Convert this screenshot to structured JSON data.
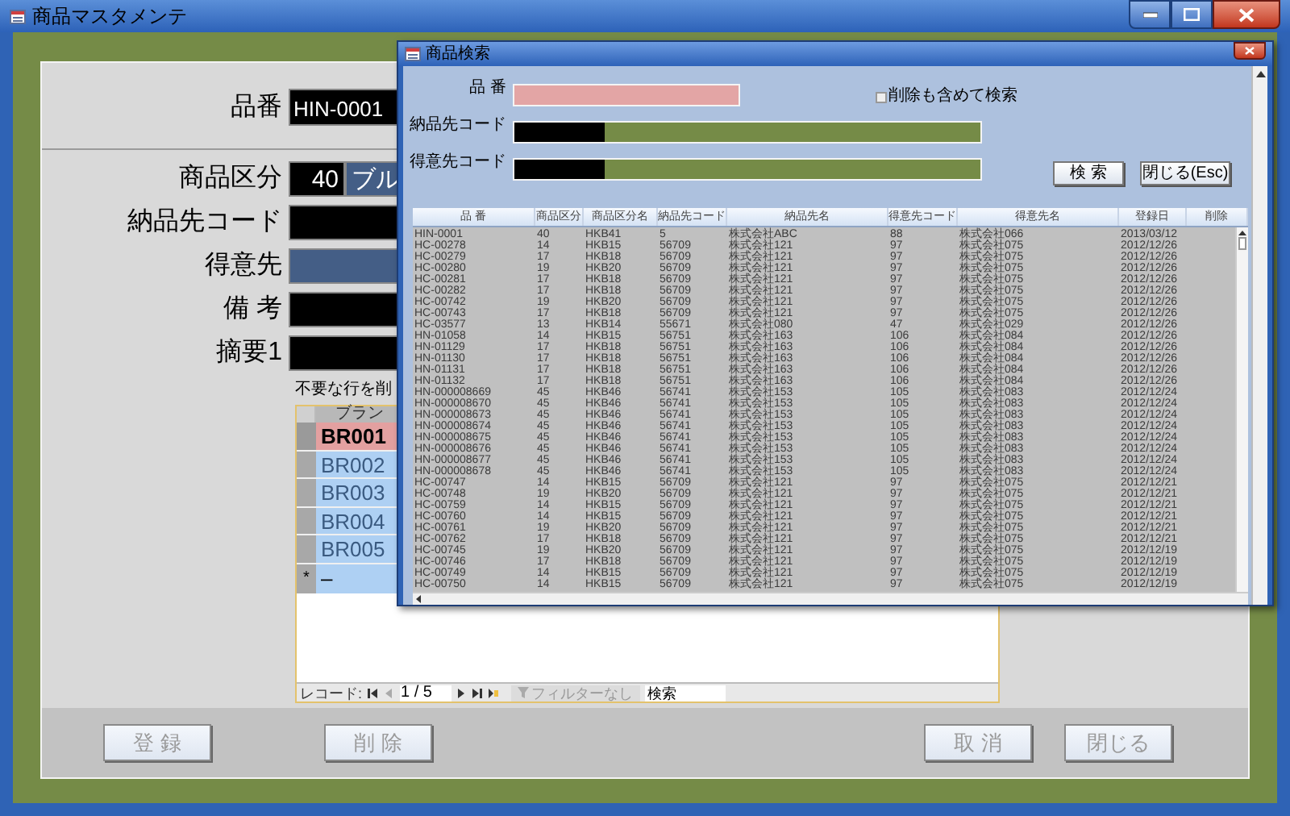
{
  "window": {
    "title": "商品マスタメンテ"
  },
  "form": {
    "key_field": {
      "label": "品番",
      "value": "HIN-0001"
    },
    "fields": [
      {
        "label": "商品区分",
        "kind": "code_name",
        "code": "40",
        "value": "ブル"
      },
      {
        "label": "納品先コード",
        "kind": "text",
        "locked": false
      },
      {
        "label": "得意先",
        "kind": "text",
        "locked": true
      },
      {
        "label": "備 考",
        "kind": "text",
        "locked": false
      },
      {
        "label": "摘要1",
        "kind": "text",
        "locked": false
      }
    ],
    "note": "不要な行を削",
    "subform": {
      "header": "ブラン",
      "rows": [
        {
          "value": "BR001",
          "selected": true
        },
        {
          "value": "BR002",
          "selected": false
        },
        {
          "value": "BR003",
          "selected": false
        },
        {
          "value": "BR004",
          "selected": false
        },
        {
          "value": "BR005",
          "selected": false
        }
      ],
      "new_row": {
        "marker": "*",
        "value": "–"
      },
      "navigation": {
        "label": "レコード:",
        "position": "1 / 5",
        "filter": "フィルターなし",
        "search": "検索"
      }
    }
  },
  "buttons": [
    "登 録",
    "削 除",
    "取 消",
    "閉じる"
  ],
  "dialog": {
    "title": "商品検索",
    "fields": [
      {
        "label": "品 番",
        "kind": "text"
      },
      {
        "label": "納品先コード",
        "kind": "code_name"
      },
      {
        "label": "得意先コード",
        "kind": "code_name"
      }
    ],
    "checkbox": {
      "label": "削除も含めて検索",
      "checked": false
    },
    "buttons": [
      "検 索",
      "閉じる(Esc)"
    ],
    "table": {
      "columns": [
        "品 番",
        "商品区分",
        "商品区分名",
        "納品先コード",
        "納品先名",
        "得意先コード",
        "得意先名",
        "登録日",
        "削除"
      ],
      "rows": [
        [
          "HIN-0001",
          "40",
          "HKB41",
          "5",
          "株式会社ABC",
          "88",
          "株式会社066",
          "2013/03/12"
        ],
        [
          "HC-00278",
          "14",
          "HKB15",
          "56709",
          "株式会社121",
          "97",
          "株式会社075",
          "2012/12/26"
        ],
        [
          "HC-00279",
          "17",
          "HKB18",
          "56709",
          "株式会社121",
          "97",
          "株式会社075",
          "2012/12/26"
        ],
        [
          "HC-00280",
          "19",
          "HKB20",
          "56709",
          "株式会社121",
          "97",
          "株式会社075",
          "2012/12/26"
        ],
        [
          "HC-00281",
          "17",
          "HKB18",
          "56709",
          "株式会社121",
          "97",
          "株式会社075",
          "2012/12/26"
        ],
        [
          "HC-00282",
          "17",
          "HKB18",
          "56709",
          "株式会社121",
          "97",
          "株式会社075",
          "2012/12/26"
        ],
        [
          "HC-00742",
          "19",
          "HKB20",
          "56709",
          "株式会社121",
          "97",
          "株式会社075",
          "2012/12/26"
        ],
        [
          "HC-00743",
          "17",
          "HKB18",
          "56709",
          "株式会社121",
          "97",
          "株式会社075",
          "2012/12/26"
        ],
        [
          "HC-03577",
          "13",
          "HKB14",
          "55671",
          "株式会社080",
          "47",
          "株式会社029",
          "2012/12/26"
        ],
        [
          "HN-01058",
          "14",
          "HKB15",
          "56751",
          "株式会社163",
          "106",
          "株式会社084",
          "2012/12/26"
        ],
        [
          "HN-01129",
          "17",
          "HKB18",
          "56751",
          "株式会社163",
          "106",
          "株式会社084",
          "2012/12/26"
        ],
        [
          "HN-01130",
          "17",
          "HKB18",
          "56751",
          "株式会社163",
          "106",
          "株式会社084",
          "2012/12/26"
        ],
        [
          "HN-01131",
          "17",
          "HKB18",
          "56751",
          "株式会社163",
          "106",
          "株式会社084",
          "2012/12/26"
        ],
        [
          "HN-01132",
          "17",
          "HKB18",
          "56751",
          "株式会社163",
          "106",
          "株式会社084",
          "2012/12/26"
        ],
        [
          "HN-000008669",
          "45",
          "HKB46",
          "56741",
          "株式会社153",
          "105",
          "株式会社083",
          "2012/12/24"
        ],
        [
          "HN-000008670",
          "45",
          "HKB46",
          "56741",
          "株式会社153",
          "105",
          "株式会社083",
          "2012/12/24"
        ],
        [
          "HN-000008673",
          "45",
          "HKB46",
          "56741",
          "株式会社153",
          "105",
          "株式会社083",
          "2012/12/24"
        ],
        [
          "HN-000008674",
          "45",
          "HKB46",
          "56741",
          "株式会社153",
          "105",
          "株式会社083",
          "2012/12/24"
        ],
        [
          "HN-000008675",
          "45",
          "HKB46",
          "56741",
          "株式会社153",
          "105",
          "株式会社083",
          "2012/12/24"
        ],
        [
          "HN-000008676",
          "45",
          "HKB46",
          "56741",
          "株式会社153",
          "105",
          "株式会社083",
          "2012/12/24"
        ],
        [
          "HN-000008677",
          "45",
          "HKB46",
          "56741",
          "株式会社153",
          "105",
          "株式会社083",
          "2012/12/24"
        ],
        [
          "HN-000008678",
          "45",
          "HKB46",
          "56741",
          "株式会社153",
          "105",
          "株式会社083",
          "2012/12/24"
        ],
        [
          "HC-00747",
          "14",
          "HKB15",
          "56709",
          "株式会社121",
          "97",
          "株式会社075",
          "2012/12/21"
        ],
        [
          "HC-00748",
          "19",
          "HKB20",
          "56709",
          "株式会社121",
          "97",
          "株式会社075",
          "2012/12/21"
        ],
        [
          "HC-00759",
          "14",
          "HKB15",
          "56709",
          "株式会社121",
          "97",
          "株式会社075",
          "2012/12/21"
        ],
        [
          "HC-00760",
          "14",
          "HKB15",
          "56709",
          "株式会社121",
          "97",
          "株式会社075",
          "2012/12/21"
        ],
        [
          "HC-00761",
          "19",
          "HKB20",
          "56709",
          "株式会社121",
          "97",
          "株式会社075",
          "2012/12/21"
        ],
        [
          "HC-00762",
          "17",
          "HKB18",
          "56709",
          "株式会社121",
          "97",
          "株式会社075",
          "2012/12/21"
        ],
        [
          "HC-00745",
          "19",
          "HKB20",
          "56709",
          "株式会社121",
          "97",
          "株式会社075",
          "2012/12/19"
        ],
        [
          "HC-00746",
          "17",
          "HKB18",
          "56709",
          "株式会社121",
          "97",
          "株式会社075",
          "2012/12/19"
        ],
        [
          "HC-00749",
          "14",
          "HKB15",
          "56709",
          "株式会社121",
          "97",
          "株式会社075",
          "2012/12/19"
        ],
        [
          "HC-00750",
          "14",
          "HKB15",
          "56709",
          "株式会社121",
          "97",
          "株式会社075",
          "2012/12/19"
        ]
      ]
    }
  }
}
